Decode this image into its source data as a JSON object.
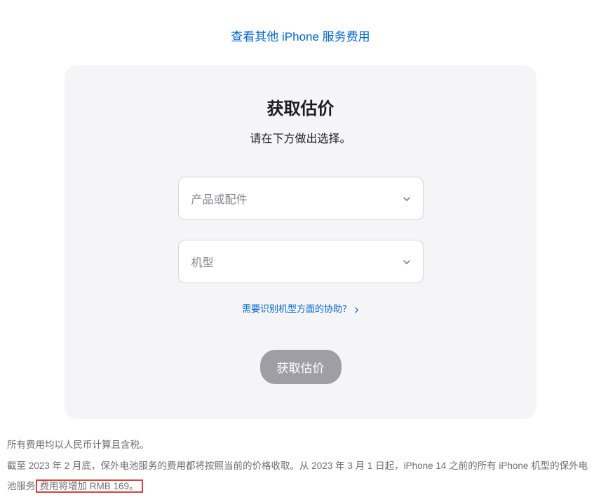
{
  "topLink": {
    "label": "查看其他 iPhone 服务费用"
  },
  "card": {
    "title": "获取估价",
    "subtitle": "请在下方做出选择。",
    "select1": {
      "placeholder": "产品或配件"
    },
    "select2": {
      "placeholder": "机型"
    },
    "helpLink": "需要识别机型方面的协助？",
    "submitLabel": "获取估价"
  },
  "footer": {
    "line1": "所有费用均以人民币计算且含税。",
    "line2_part1": "截至 2023 年 2 月底，保外电池服务的费用都将按照当前的价格收取。从 2023 年 3 月 1 日起，iPhone 14 之前的所有 iPhone 机型的保外电池服务",
    "line2_highlight": "费用将增加 RMB 169。"
  }
}
